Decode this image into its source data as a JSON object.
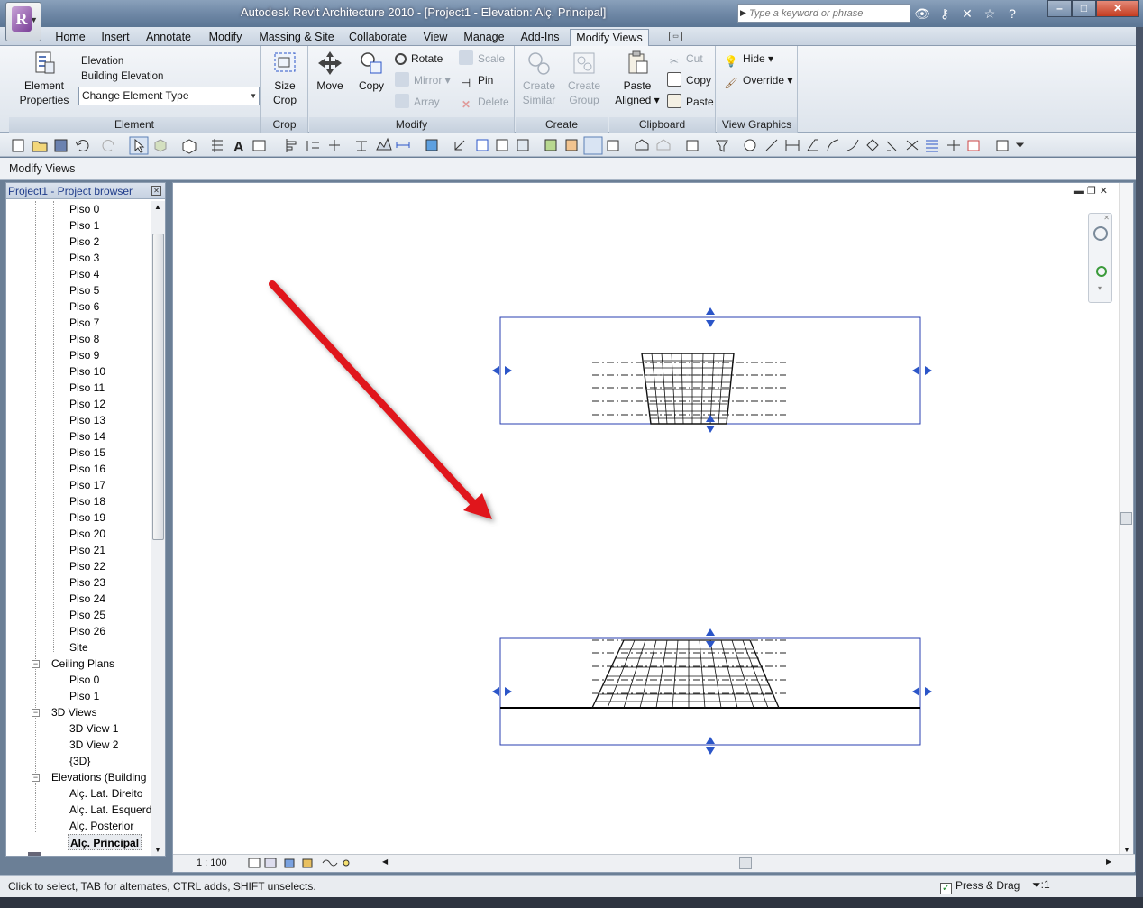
{
  "window": {
    "title": "Autodesk Revit Architecture 2010 - [Project1 - Elevation: Alç. Principal]",
    "search_placeholder": "Type a keyword or phrase"
  },
  "tabs": [
    "Home",
    "Insert",
    "Annotate",
    "Modify",
    "Massing & Site",
    "Collaborate",
    "View",
    "Manage",
    "Add-Ins",
    "Modify Views"
  ],
  "active_tab": "Modify Views",
  "ribbon": {
    "element": {
      "label": "Element",
      "properties_line1": "Element",
      "properties_line2": "Properties",
      "type_line1": "Elevation",
      "type_line2": "Building Elevation",
      "change_type": "Change Element Type"
    },
    "crop": {
      "label": "Crop",
      "size_line1": "Size",
      "size_line2": "Crop"
    },
    "modify": {
      "label": "Modify",
      "move": "Move",
      "copy": "Copy",
      "rotate": "Rotate",
      "mirror": "Mirror",
      "array": "Array",
      "scale": "Scale",
      "pin": "Pin",
      "delete": "Delete"
    },
    "create": {
      "label": "Create",
      "similar_line1": "Create",
      "similar_line2": "Similar",
      "group_line1": "Create",
      "group_line2": "Group"
    },
    "clipboard": {
      "label": "Clipboard",
      "paste_line1": "Paste",
      "paste_line2": "Aligned",
      "cut": "Cut",
      "copy": "Copy",
      "paste": "Paste"
    },
    "view_graphics": {
      "label": "View Graphics",
      "hide": "Hide",
      "override": "Override"
    }
  },
  "options_bar": {
    "text": "Modify Views"
  },
  "browser": {
    "title": "Project1 - Project browser",
    "floor_items": [
      "Piso 0",
      "Piso 1",
      "Piso 2",
      "Piso 3",
      "Piso 4",
      "Piso 5",
      "Piso 6",
      "Piso 7",
      "Piso 8",
      "Piso 9",
      "Piso 10",
      "Piso 11",
      "Piso 12",
      "Piso 13",
      "Piso 14",
      "Piso 15",
      "Piso 16",
      "Piso 17",
      "Piso 18",
      "Piso 19",
      "Piso 20",
      "Piso 21",
      "Piso 22",
      "Piso 23",
      "Piso 24",
      "Piso 25",
      "Piso 26",
      "Site"
    ],
    "ceiling_plans": {
      "label": "Ceiling Plans",
      "items": [
        "Piso 0",
        "Piso 1"
      ]
    },
    "views_3d": {
      "label": "3D Views",
      "items": [
        "3D View 1",
        "3D View 2",
        "{3D}"
      ]
    },
    "elevations": {
      "label": "Elevations (Building",
      "items": [
        "Alç. Lat. Direito",
        "Alç. Lat. Esquerd",
        "Alç. Posterior",
        "Alç. Principal"
      ]
    },
    "selected_item": "Alç. Principal"
  },
  "view_control": {
    "scale": "1 : 100"
  },
  "status": {
    "text": "Click to select, TAB for alternates, CTRL adds, SHIFT unselects.",
    "press_drag": "Press & Drag",
    "press_drag_checked": true,
    "filter_count": ":1"
  },
  "colors": {
    "accent_blue": "#2b55c8",
    "arrow_red": "#e0121a",
    "crop_region": "#2a3fb0"
  }
}
